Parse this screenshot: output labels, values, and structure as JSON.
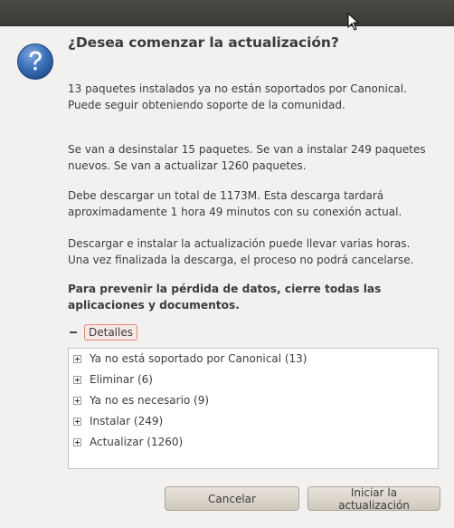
{
  "dialog": {
    "title": "¿Desea comenzar la actualización?",
    "paragraphs": [
      "13 paquetes instalados ya no están soportados por Canonical. Puede seguir obteniendo soporte de la comunidad.",
      "Se van a desinstalar 15 paquetes. Se van a instalar 249 paquetes nuevos. Se van a actualizar 1260 paquetes.",
      "Debe descargar un total de 1173M. Esta descarga tardará aproximadamente 1 hora 49 minutos con su conexión actual.",
      "Descargar e instalar la actualización puede llevar varias horas. Una vez finalizada la descarga, el proceso no podrá cancelarse."
    ],
    "warning": "Para prevenir la pérdida de datos, cierre todas las aplicaciones y documentos.",
    "icon": "question-icon"
  },
  "details": {
    "label": "Detalles",
    "items": [
      {
        "label": "Ya no está soportado por Canonical (13)"
      },
      {
        "label": "Eliminar (6)"
      },
      {
        "label": "Ya no es necesario (9)"
      },
      {
        "label": "Instalar (249)"
      },
      {
        "label": "Actualizar (1260)"
      }
    ]
  },
  "buttons": {
    "cancel": "Cancelar",
    "start": "Iniciar la actualización"
  },
  "colors": {
    "background": "#f2f1f0",
    "titlebar": "#3c3b37",
    "icon_blue": "#3a6fb8",
    "expander_border": "#e0897a"
  }
}
